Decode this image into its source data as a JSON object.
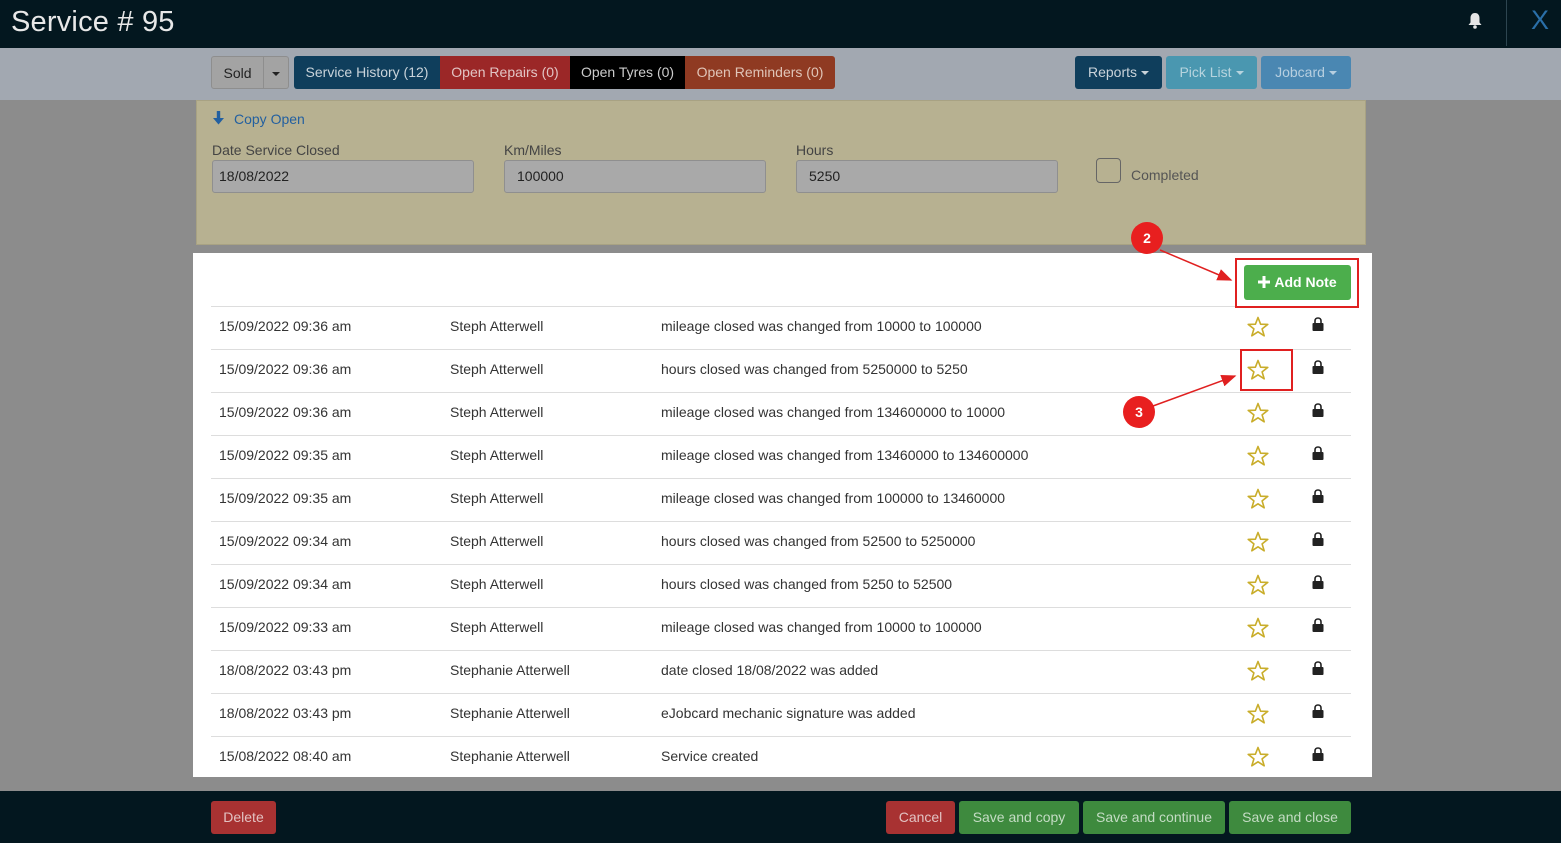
{
  "window": {
    "title": "Service # 95",
    "close": "X"
  },
  "toolbar": {
    "sold": "Sold",
    "service_history": "Service History (12)",
    "open_repairs": "Open Repairs (0)",
    "open_tyres": "Open Tyres (0)",
    "open_reminders": "Open Reminders (0)",
    "reports": "Reports",
    "pick_list": "Pick List",
    "jobcard": "Jobcard"
  },
  "form": {
    "copy_open": "Copy Open",
    "date_label": "Date Service Closed",
    "date_value": "18/08/2022",
    "km_label": "Km/Miles",
    "km_value": "100000",
    "hours_label": "Hours",
    "hours_value": "5250",
    "completed_label": "Completed"
  },
  "notes": {
    "add_note": "Add Note",
    "rows": [
      {
        "date": "15/09/2022 09:36 am",
        "user": "Steph Atterwell",
        "desc": "mileage closed was changed from 10000 to 100000"
      },
      {
        "date": "15/09/2022 09:36 am",
        "user": "Steph Atterwell",
        "desc": "hours closed was changed from 5250000 to 5250"
      },
      {
        "date": "15/09/2022 09:36 am",
        "user": "Steph Atterwell",
        "desc": "mileage closed was changed from 134600000 to 10000"
      },
      {
        "date": "15/09/2022 09:35 am",
        "user": "Steph Atterwell",
        "desc": "mileage closed was changed from 13460000 to 134600000"
      },
      {
        "date": "15/09/2022 09:35 am",
        "user": "Steph Atterwell",
        "desc": "mileage closed was changed from 100000 to 13460000"
      },
      {
        "date": "15/09/2022 09:34 am",
        "user": "Steph Atterwell",
        "desc": "hours closed was changed from 52500 to 5250000"
      },
      {
        "date": "15/09/2022 09:34 am",
        "user": "Steph Atterwell",
        "desc": "hours closed was changed from 5250 to 52500"
      },
      {
        "date": "15/09/2022 09:33 am",
        "user": "Steph Atterwell",
        "desc": "mileage closed was changed from 10000 to 100000"
      },
      {
        "date": "18/08/2022 03:43 pm",
        "user": "Stephanie Atterwell",
        "desc": "date closed 18/08/2022 was added"
      },
      {
        "date": "18/08/2022 03:43 pm",
        "user": "Stephanie Atterwell",
        "desc": "eJobcard mechanic signature was added"
      },
      {
        "date": "15/08/2022 08:40 am",
        "user": "Stephanie Atterwell",
        "desc": "Service created"
      }
    ]
  },
  "annotations": {
    "badge_2": "2",
    "badge_3": "3"
  },
  "footer": {
    "delete": "Delete",
    "cancel": "Cancel",
    "save_copy": "Save and copy",
    "save_continue": "Save and continue",
    "save_close": "Save and close"
  },
  "colors": {
    "title_bar": "#03171f",
    "service_history": "#0f3e5c",
    "open_repairs": "#9b2727",
    "open_tyres": "#000000",
    "open_reminders": "#8f3a22",
    "add_note": "#4cae4c",
    "star": "#c9ad2a",
    "annotation": "#e81f1f"
  }
}
